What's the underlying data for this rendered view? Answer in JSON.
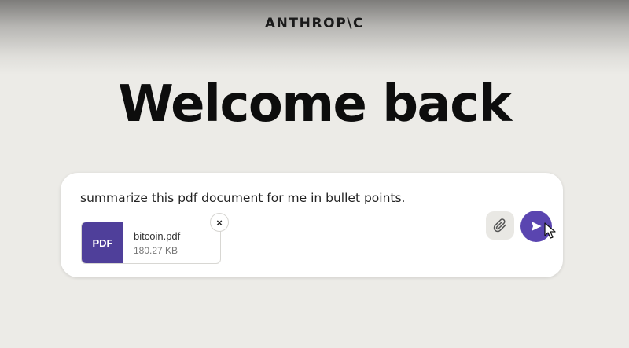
{
  "header": {
    "logo_text": "ANTHROP\\C"
  },
  "hero": {
    "title": "Welcome back"
  },
  "composer": {
    "prompt": "summarize this pdf document for me in bullet points.",
    "attachment": {
      "type_label": "PDF",
      "file_name": "bitcoin.pdf",
      "file_size": "180.27 KB",
      "remove_icon": "×"
    },
    "attach_icon": "paperclip-icon",
    "send_icon": "send-arrow-icon"
  },
  "colors": {
    "background": "#ecebe7",
    "accent": "#5a45b0",
    "pdf_badge": "#4f3f9a"
  }
}
